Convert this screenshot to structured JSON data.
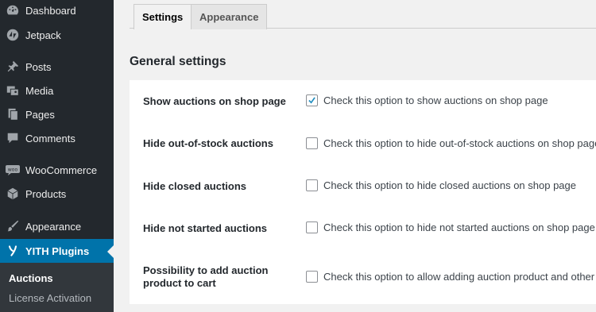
{
  "sidebar": {
    "items": [
      {
        "label": "Dashboard",
        "icon": "dashboard-icon"
      },
      {
        "label": "Jetpack",
        "icon": "jetpack-icon"
      },
      {
        "label": "Posts",
        "icon": "pin-icon"
      },
      {
        "label": "Media",
        "icon": "media-icon"
      },
      {
        "label": "Pages",
        "icon": "pages-icon"
      },
      {
        "label": "Comments",
        "icon": "comments-icon"
      },
      {
        "label": "WooCommerce",
        "icon": "woocommerce-icon"
      },
      {
        "label": "Products",
        "icon": "products-box-icon"
      },
      {
        "label": "Appearance",
        "icon": "paintbrush-icon"
      },
      {
        "label": "YITH Plugins",
        "icon": "yith-logo-icon"
      }
    ],
    "submenu": [
      {
        "label": "Auctions"
      },
      {
        "label": "License Activation"
      }
    ],
    "active_color": "#0073aa",
    "background_color": "#23282d"
  },
  "tabs": [
    {
      "label": "Settings",
      "active": true
    },
    {
      "label": "Appearance",
      "active": false
    }
  ],
  "section_title": "General settings",
  "settings": [
    {
      "label": "Show auctions on shop page",
      "checked": true,
      "description": "Check this option to show auctions on shop page"
    },
    {
      "label": "Hide out-of-stock auctions",
      "checked": false,
      "description": "Check this option to hide out-of-stock auctions on shop page"
    },
    {
      "label": "Hide closed auctions",
      "checked": false,
      "description": "Check this option to hide closed auctions on shop page"
    },
    {
      "label": "Hide not started auctions",
      "checked": false,
      "description": "Check this option to hide not started auctions on shop page"
    },
    {
      "label": "Possibility to add auction product to cart",
      "checked": false,
      "description": "Check this option to allow adding auction product and other p"
    }
  ]
}
